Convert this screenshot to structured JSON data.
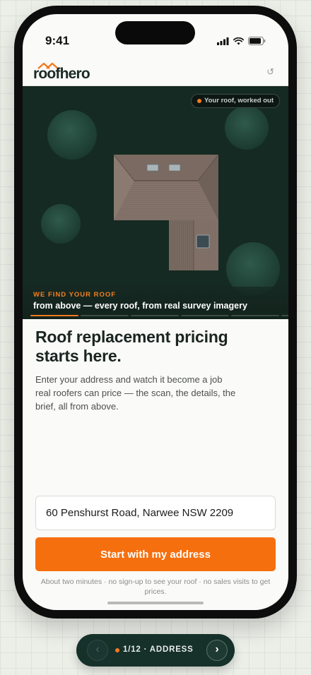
{
  "status_bar": {
    "time": "9:41",
    "icons": [
      "signal-icon",
      "wifi-icon",
      "battery-icon"
    ]
  },
  "header": {
    "logo_text": "roofhero",
    "reset_icon": "reset-icon"
  },
  "hero": {
    "badge": "Your roof, worked out",
    "kicker": "WE FIND YOUR ROOF",
    "line": "from above — every roof, from real survey imagery",
    "progress_active_index": 0,
    "progress_segments": 6
  },
  "main": {
    "title": "Roof replacement pricing starts here.",
    "subtitle": "Enter your address and watch it become a job real roofers can price — the scan, the details, the brief, all from above."
  },
  "form": {
    "address_value": "60 Penshurst Road, Narwee NSW 2209",
    "cta_label": "Start with my address",
    "fineprint": "About two minutes · no sign-up to see your roof · no sales visits to get prices."
  },
  "deck_nav": {
    "prev_label": "‹",
    "next_label": "›",
    "position_label": "1/12 · ADDRESS"
  },
  "colors": {
    "accent": "#f66f0f",
    "dark_green": "#13281f",
    "text_dark": "#1a2421"
  }
}
